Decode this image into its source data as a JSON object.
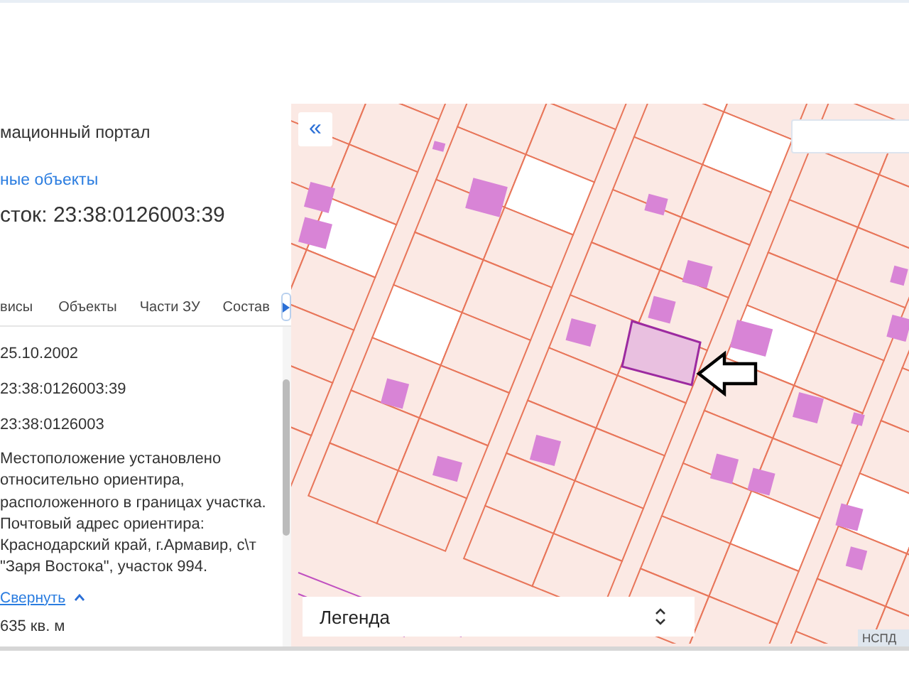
{
  "panel": {
    "portal_title": "мационный портал",
    "objects_link": "ные объекты",
    "parcel_title": "сток: 23:38:0126003:39"
  },
  "tabs": [
    {
      "label": "висы"
    },
    {
      "label": "Объекты"
    },
    {
      "label": "Части ЗУ"
    },
    {
      "label": "Состав"
    }
  ],
  "details": {
    "values": [
      "25.10.2002",
      "23:38:0126003:39",
      "23:38:0126003"
    ],
    "address": "Местоположение установлено относительно ориентира, расположенного в границах участка. Почтовый адрес ориентира: Краснодарский край, г.Армавир, с\\т \"Заря Востока\", участок 994.",
    "collapse_link": "Свернуть",
    "area": "635 кв. м"
  },
  "map": {
    "collapse_button": "«",
    "legend": "Легенда",
    "attribution": "НСПД"
  }
}
